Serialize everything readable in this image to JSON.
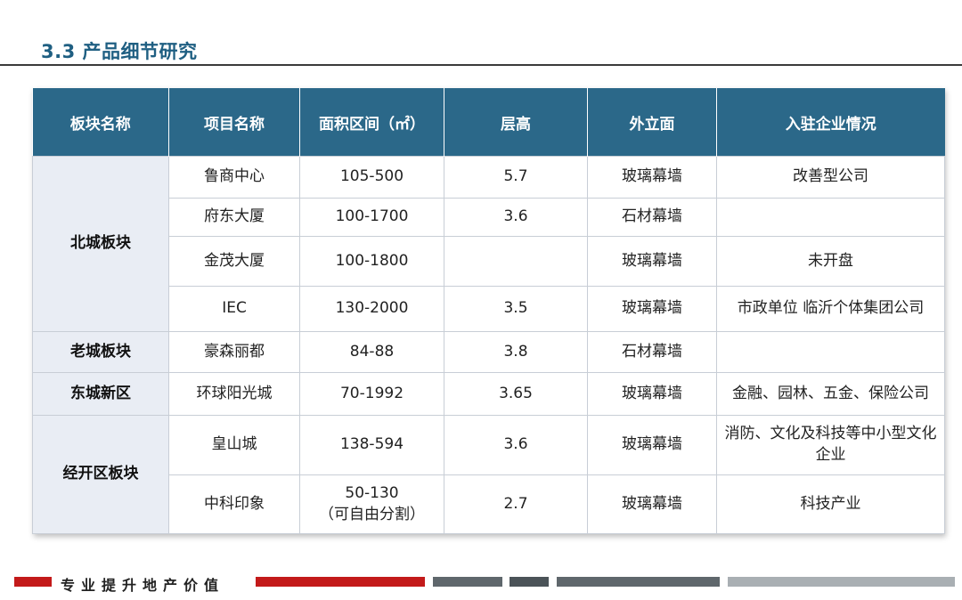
{
  "title": "3.3 产品细节研究",
  "table": {
    "headers": [
      "板块名称",
      "项目名称",
      "面积区间（㎡）",
      "层高",
      "外立面",
      "入驻企业情况"
    ],
    "regions": [
      "北城板块",
      "老城板块",
      "东城新区",
      "经开区板块"
    ],
    "rows": [
      {
        "project": "鲁商中心",
        "area": "105-500",
        "area_note": "",
        "height": "5.7",
        "facade": "玻璃幕墙",
        "tenants": "改善型公司"
      },
      {
        "project": "府东大厦",
        "area": "100-1700",
        "area_note": "",
        "height": "3.6",
        "facade": "石材幕墙",
        "tenants": ""
      },
      {
        "project": "金茂大厦",
        "area": "100-1800",
        "area_note": "",
        "height": "",
        "facade": "玻璃幕墙",
        "tenants": "未开盘"
      },
      {
        "project": "IEC",
        "area": "130-2000",
        "area_note": "",
        "height": "3.5",
        "facade": "玻璃幕墙",
        "tenants": "市政单位 临沂个体集团公司"
      },
      {
        "project": "豪森丽都",
        "area": "84-88",
        "area_note": "",
        "height": "3.8",
        "facade": "石材幕墙",
        "tenants": ""
      },
      {
        "project": "环球阳光城",
        "area": "70-1992",
        "area_note": "",
        "height": "3.65",
        "facade": "玻璃幕墙",
        "tenants": "金融、园林、五金、保险公司"
      },
      {
        "project": "皇山城",
        "area": "138-594",
        "area_note": "",
        "height": "3.6",
        "facade": "玻璃幕墙",
        "tenants": "消防、文化及科技等中小型文化企业"
      },
      {
        "project": "中科印象",
        "area": "50-130",
        "area_note": "（可自由分割）",
        "height": "2.7",
        "facade": "玻璃幕墙",
        "tenants": "科技产业"
      }
    ]
  },
  "footer": {
    "slogan": "专业提升地产价值",
    "colors": {
      "red": "#c31a1a",
      "dark_gray": "#4b5358",
      "mid_gray": "#5f676c",
      "light_gray": "#a9afb3"
    }
  }
}
